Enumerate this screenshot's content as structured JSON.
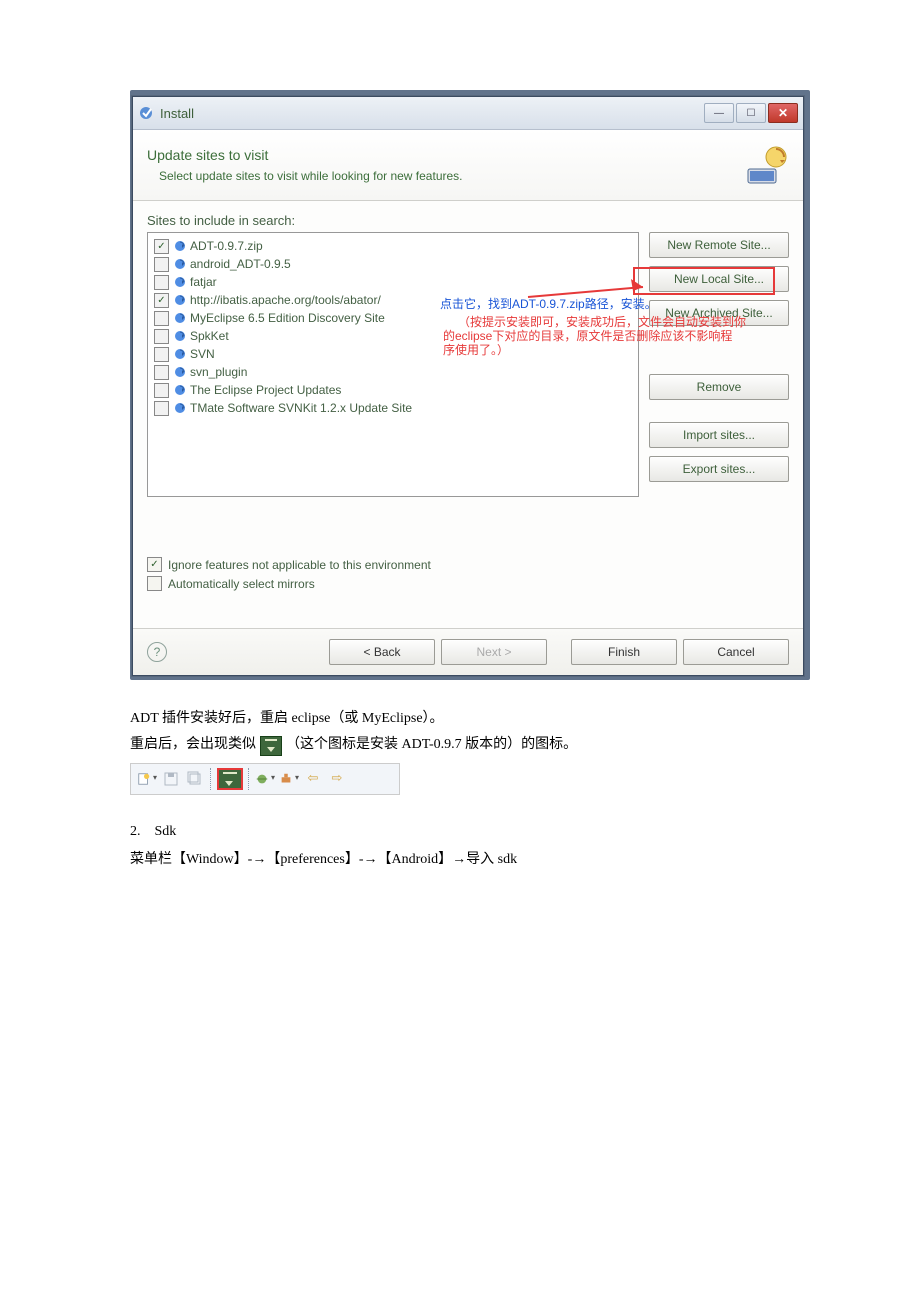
{
  "dialog": {
    "title": "Install",
    "header_title": "Update sites to visit",
    "header_subtitle": "Select update sites to visit while looking for new features.",
    "section_label": "Sites to include in search:",
    "sites": [
      {
        "label": "ADT-0.9.7.zip",
        "checked": true
      },
      {
        "label": "android_ADT-0.9.5",
        "checked": false
      },
      {
        "label": "fatjar",
        "checked": false
      },
      {
        "label": "http://ibatis.apache.org/tools/abator/",
        "checked": true
      },
      {
        "label": "MyEclipse 6.5 Edition Discovery Site",
        "checked": false
      },
      {
        "label": "SpkKet",
        "checked": false
      },
      {
        "label": "SVN",
        "checked": false
      },
      {
        "label": "svn_plugin",
        "checked": false
      },
      {
        "label": "The Eclipse Project Updates",
        "checked": false
      },
      {
        "label": "TMate Software SVNKit 1.2.x Update Site",
        "checked": false
      }
    ],
    "buttons": {
      "new_remote": "New Remote Site...",
      "new_local": "New Local Site...",
      "new_archived": "New Archived Site...",
      "remove": "Remove",
      "import": "Import sites...",
      "export": "Export sites..."
    },
    "opts": {
      "ignore_features": "Ignore features not applicable to this environment",
      "auto_mirrors": "Automatically select mirrors"
    },
    "wizard": {
      "back": "< Back",
      "next": "Next >",
      "finish": "Finish",
      "cancel": "Cancel"
    }
  },
  "annotations": {
    "blue": "点击它，找到ADT-0.9.7.zip路径，安装。",
    "red_line1": "（按提示安装即可，安装成功后，文件会自动安装到你",
    "red_line2": "的eclipse下对应的目录，原文件是否删除应该不影响程",
    "red_line3": "序使用了。）"
  },
  "prose": {
    "p1": "ADT 插件安装好后，重启 eclipse（或 MyEclipse）。",
    "p2a": "重启后，会出现类似",
    "p2b": "（这个图标是安装 ADT-0.9.7 版本的）的图标。",
    "sdk_num": "2.",
    "sdk_label": "Sdk",
    "sdk_line": "菜单栏【Window】-→【preferences】-→【Android】→导入 sdk"
  }
}
